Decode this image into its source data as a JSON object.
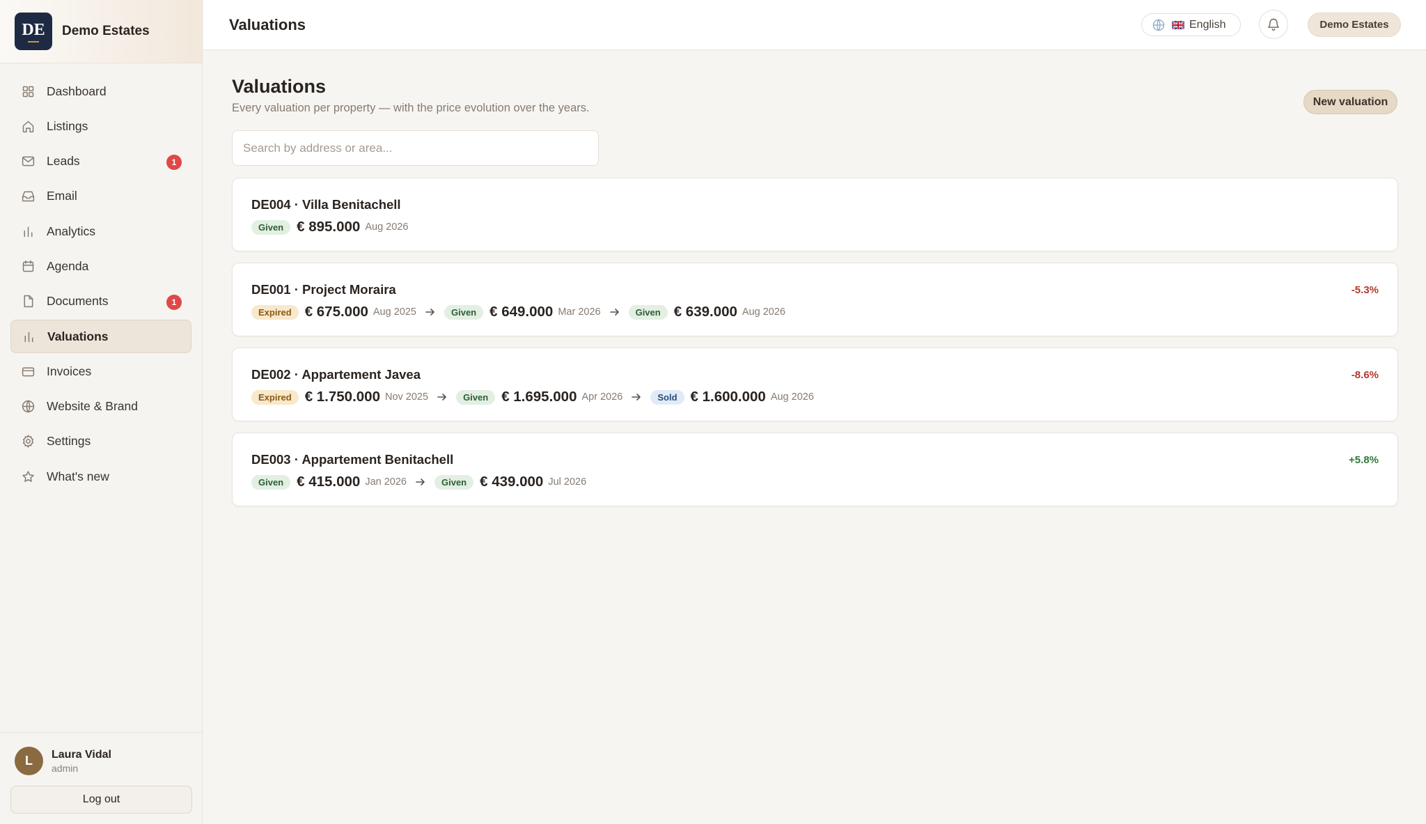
{
  "brand": {
    "logo_text": "DE",
    "name": "Demo Estates"
  },
  "sidebar": {
    "items": [
      {
        "label": "Dashboard",
        "icon": "grid-icon"
      },
      {
        "label": "Listings",
        "icon": "home-icon"
      },
      {
        "label": "Leads",
        "icon": "mail-icon",
        "badge": "1"
      },
      {
        "label": "Email",
        "icon": "inbox-icon"
      },
      {
        "label": "Analytics",
        "icon": "bar-chart-icon"
      },
      {
        "label": "Agenda",
        "icon": "calendar-icon"
      },
      {
        "label": "Documents",
        "icon": "file-icon",
        "badge": "1"
      },
      {
        "label": "Valuations",
        "icon": "bar-chart-icon",
        "active": true
      },
      {
        "label": "Invoices",
        "icon": "credit-card-icon"
      },
      {
        "label": "Website & Brand",
        "icon": "globe-icon"
      },
      {
        "label": "Settings",
        "icon": "gear-icon"
      },
      {
        "label": "What's new",
        "icon": "star-icon"
      }
    ]
  },
  "user": {
    "initial": "L",
    "name": "Laura Vidal",
    "role": "admin",
    "logout_label": "Log out"
  },
  "topbar": {
    "title": "Valuations",
    "language": "English",
    "workspace": "Demo Estates"
  },
  "page": {
    "title": "Valuations",
    "subtitle": "Every valuation per property — with the price evolution over the years.",
    "new_button": "New valuation",
    "search_placeholder": "Search by address or area..."
  },
  "colors": {
    "accent": "#e6d9c6",
    "sidebar_active": "#ede5da",
    "badge": "#e04848",
    "negative": "#b03a2e",
    "positive": "#2f7a3a"
  },
  "valuations": [
    {
      "title": "DE004 · Villa Benitachell",
      "change": "",
      "entries": [
        {
          "status": "Given",
          "price": "€ 895.000",
          "date": "Aug 2026"
        }
      ]
    },
    {
      "title": "DE001 · Project Moraira",
      "change": "-5.3%",
      "entries": [
        {
          "status": "Expired",
          "price": "€ 675.000",
          "date": "Aug 2025"
        },
        {
          "status": "Given",
          "price": "€ 649.000",
          "date": "Mar 2026"
        },
        {
          "status": "Given",
          "price": "€ 639.000",
          "date": "Aug 2026"
        }
      ]
    },
    {
      "title": "DE002 · Appartement Javea",
      "change": "-8.6%",
      "entries": [
        {
          "status": "Expired",
          "price": "€ 1.750.000",
          "date": "Nov 2025"
        },
        {
          "status": "Given",
          "price": "€ 1.695.000",
          "date": "Apr 2026"
        },
        {
          "status": "Sold",
          "price": "€ 1.600.000",
          "date": "Aug 2026"
        }
      ]
    },
    {
      "title": "DE003 · Appartement Benitachell",
      "change": "+5.8%",
      "entries": [
        {
          "status": "Given",
          "price": "€ 415.000",
          "date": "Jan 2026"
        },
        {
          "status": "Given",
          "price": "€ 439.000",
          "date": "Jul 2026"
        }
      ]
    }
  ]
}
